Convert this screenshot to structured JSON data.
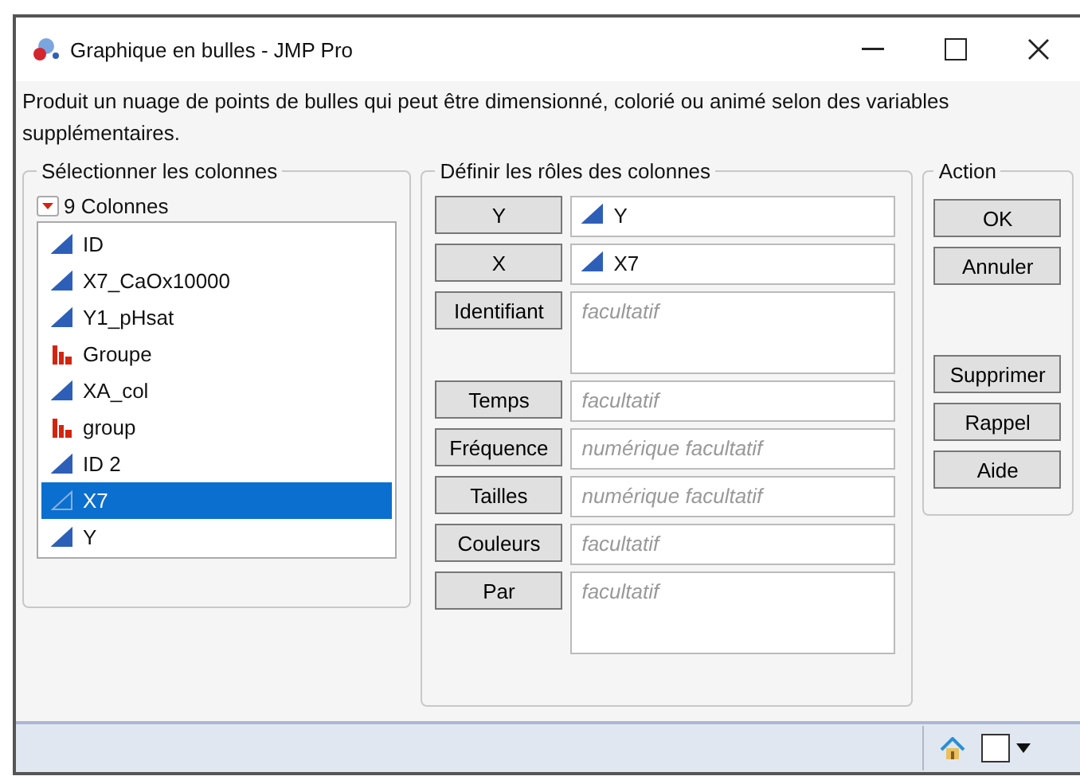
{
  "window": {
    "title": "Graphique en bulles - JMP Pro"
  },
  "description": "Produit un nuage de points de bulles qui peut être dimensionné, colorié ou animé selon des variables supplémentaires.",
  "columns_panel": {
    "title": "Sélectionner les colonnes",
    "count": "9 Colonnes",
    "columns": [
      {
        "name": "ID",
        "kind": "continuous",
        "selected": false
      },
      {
        "name": "X7_CaOx10000",
        "kind": "continuous",
        "selected": false
      },
      {
        "name": "Y1_pHsat",
        "kind": "continuous",
        "selected": false
      },
      {
        "name": "Groupe",
        "kind": "nominal",
        "selected": false
      },
      {
        "name": "XA_col",
        "kind": "continuous",
        "selected": false
      },
      {
        "name": "group",
        "kind": "nominal",
        "selected": false
      },
      {
        "name": "ID 2",
        "kind": "continuous",
        "selected": false
      },
      {
        "name": "X7",
        "kind": "continuous",
        "selected": true
      },
      {
        "name": "Y",
        "kind": "continuous",
        "selected": false
      }
    ]
  },
  "roles_panel": {
    "title": "Définir les rôles des colonnes",
    "roles": [
      {
        "label": "Y",
        "value": "Y",
        "tall": false
      },
      {
        "label": "X",
        "value": "X7",
        "tall": false
      },
      {
        "label": "Identifiant",
        "placeholder": "facultatif",
        "tall": true
      },
      {
        "label": "Temps",
        "placeholder": "facultatif",
        "tall": false
      },
      {
        "label": "Fréquence",
        "placeholder": "numérique facultatif",
        "tall": false
      },
      {
        "label": "Tailles",
        "placeholder": "numérique facultatif",
        "tall": false
      },
      {
        "label": "Couleurs",
        "placeholder": "facultatif",
        "tall": false
      },
      {
        "label": "Par",
        "placeholder": "facultatif",
        "tall": true
      }
    ]
  },
  "action_panel": {
    "title": "Action",
    "buttons": [
      "OK",
      "Annuler"
    ],
    "more_buttons": [
      "Supprimer",
      "Rappel",
      "Aide"
    ]
  }
}
